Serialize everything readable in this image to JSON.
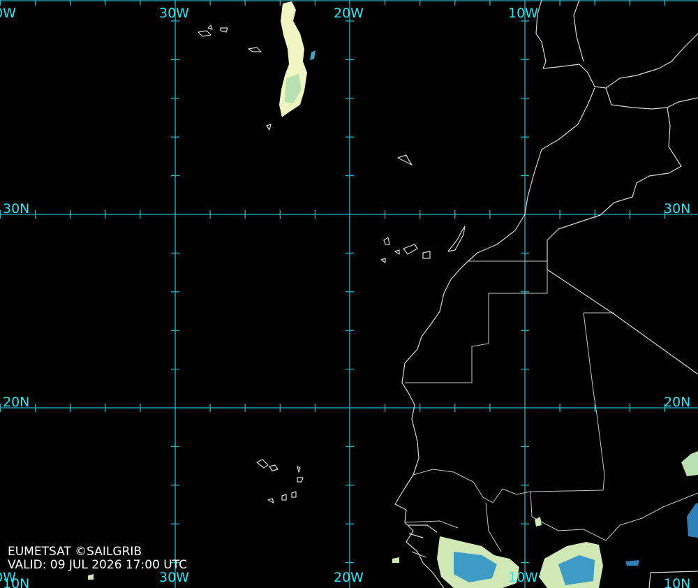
{
  "map": {
    "longitude_labels": [
      "0W",
      "30W",
      "20W",
      "10W"
    ],
    "bottom_longitude_labels": [
      "0W",
      "30W",
      "20W",
      "10W",
      "10N"
    ],
    "latitude_labels": [
      "30N",
      "20N"
    ],
    "colors": {
      "background": "#000000",
      "graticule": "#1fb5c4",
      "labels": "#2ee6f2",
      "coastline": "#d8d8d8",
      "cloud_light": "#f2f7c8",
      "cloud_mid": "#a8d8b0",
      "cloud_deep": "#3a9ac8"
    }
  },
  "credit": {
    "source": "EUMETSAT ©SAILGRIB",
    "valid": "VALID:  09 JUL 2026 17:00 UTC"
  }
}
